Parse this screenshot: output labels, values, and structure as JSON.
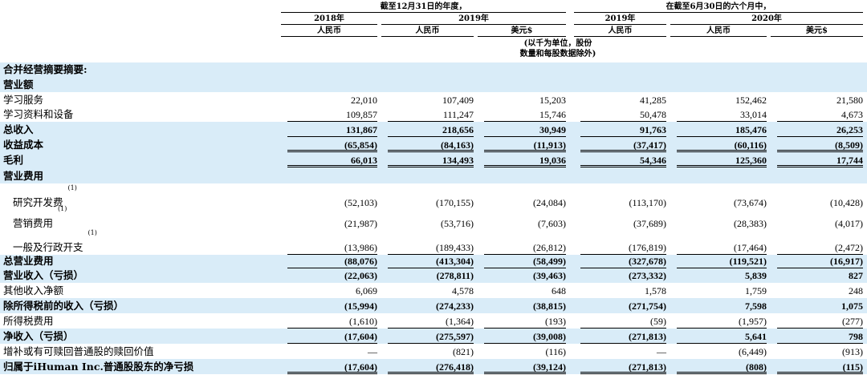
{
  "header": {
    "period_year": "截至12月31日的年度，",
    "period_six": "在截至6月30日的六个月中，",
    "year_2018": "2018年",
    "year_2019a": "2019年",
    "year_2019b": "2019年",
    "year_2020": "2020年",
    "cur_rmb": "人民币",
    "cur_usd": "美元$",
    "note_line1": "(以千为单位，股份",
    "note_line2": "数量和每股数据除外)"
  },
  "section_title": "合并经营摘要摘要:",
  "rows": [
    {
      "label": "营业额",
      "bold": true,
      "values": [
        "",
        "",
        "",
        "",
        "",
        ""
      ]
    },
    {
      "label": "学习服务",
      "values": [
        "22,010",
        "107,409",
        "15,203",
        "41,285",
        "152,462",
        "21,580"
      ]
    },
    {
      "label": "学习资料和设备",
      "values": [
        "109,857",
        "111,247",
        "15,746",
        "50,478",
        "33,014",
        "4,673"
      ]
    },
    {
      "label": "总收入",
      "bold": true,
      "values": [
        "131,867",
        "218,656",
        "30,949",
        "91,763",
        "185,476",
        "26,253"
      ]
    },
    {
      "label": "收益成本",
      "bold": true,
      "values": [
        "(65,854)",
        "(84,163)",
        "(11,913)",
        "(37,417)",
        "(60,116)",
        "(8,509)"
      ]
    },
    {
      "label": "毛利",
      "bold": true,
      "values": [
        "66,013",
        "134,493",
        "19,036",
        "54,346",
        "125,360",
        "17,744"
      ]
    },
    {
      "label": "营业费用",
      "bold": true,
      "values": [
        "",
        "",
        "",
        "",
        "",
        ""
      ]
    },
    {
      "label": "研究开发费",
      "sup": "(1)",
      "indent": true,
      "values": [
        "(52,103)",
        "(170,155)",
        "(24,084)",
        "(113,170)",
        "(73,674)",
        "(10,428)"
      ]
    },
    {
      "label": "营销费用",
      "sup": "(1)",
      "indent": true,
      "values": [
        "(21,987)",
        "(53,716)",
        "(7,603)",
        "(37,689)",
        "(28,383)",
        "(4,017)"
      ]
    },
    {
      "label": "一般及行政开支",
      "sup": "(1)",
      "indent": true,
      "values": [
        "(13,986)",
        "(189,433)",
        "(26,812)",
        "(176,819)",
        "(17,464)",
        "(2,472)"
      ]
    },
    {
      "label": "总营业费用",
      "bold": true,
      "values": [
        "(88,076)",
        "(413,304)",
        "(58,499)",
        "(327,678)",
        "(119,521)",
        "(16,917)"
      ]
    },
    {
      "label": "营业收入（亏损）",
      "bold": true,
      "values": [
        "(22,063)",
        "(278,811)",
        "(39,463)",
        "(273,332)",
        "5,839",
        "827"
      ]
    },
    {
      "label": "其他收入净额",
      "values": [
        "6,069",
        "4,578",
        "648",
        "1,578",
        "1,759",
        "248"
      ]
    },
    {
      "label": "除所得税前的收入（亏损）",
      "bold": true,
      "values": [
        "(15,994)",
        "(274,233)",
        "(38,815)",
        "(271,754)",
        "7,598",
        "1,075"
      ]
    },
    {
      "label": "所得税费用",
      "values": [
        "(1,610)",
        "(1,364)",
        "(193)",
        "(59)",
        "(1,957)",
        "(277)"
      ]
    },
    {
      "label": "净收入（亏损）",
      "bold": true,
      "values": [
        "(17,604)",
        "(275,597)",
        "(39,008)",
        "(271,813)",
        "5,641",
        "798"
      ]
    },
    {
      "label": "增补或有可赎回普通股的赎回价值",
      "values": [
        "—",
        "(821)",
        "(116)",
        "—",
        "(6,449)",
        "(913)"
      ]
    },
    {
      "label": "归属于iHuman Inc.普通股股东的净亏损",
      "bold": true,
      "values": [
        "(17,604)",
        "(276,418)",
        "(39,124)",
        "(271,813)",
        "(808)",
        "(115)"
      ]
    }
  ]
}
